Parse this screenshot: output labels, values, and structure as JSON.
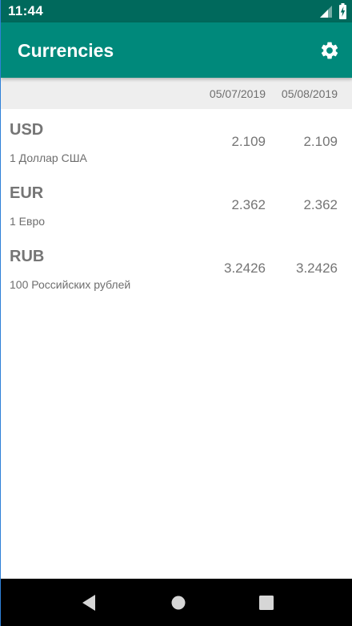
{
  "status_bar": {
    "time": "11:44",
    "icons": [
      "signal-icon",
      "battery-icon"
    ]
  },
  "app_bar": {
    "title": "Currencies",
    "settings_icon": "gear-icon"
  },
  "dates": [
    "05/07/2019",
    "05/08/2019"
  ],
  "currencies": [
    {
      "code": "USD",
      "name": "1 Доллар США",
      "rates": [
        "2.109",
        "2.109"
      ]
    },
    {
      "code": "EUR",
      "name": "1 Евро",
      "rates": [
        "2.362",
        "2.362"
      ]
    },
    {
      "code": "RUB",
      "name": "100 Российских рублей",
      "rates": [
        "3.2426",
        "3.2426"
      ]
    }
  ],
  "nav_bar": {
    "icons": [
      "back-icon",
      "home-icon",
      "recents-icon"
    ]
  },
  "colors": {
    "status_bar": "#00695c",
    "app_bar": "#00897b",
    "header_bg": "#eeeeee",
    "text_gray": "#757575"
  }
}
